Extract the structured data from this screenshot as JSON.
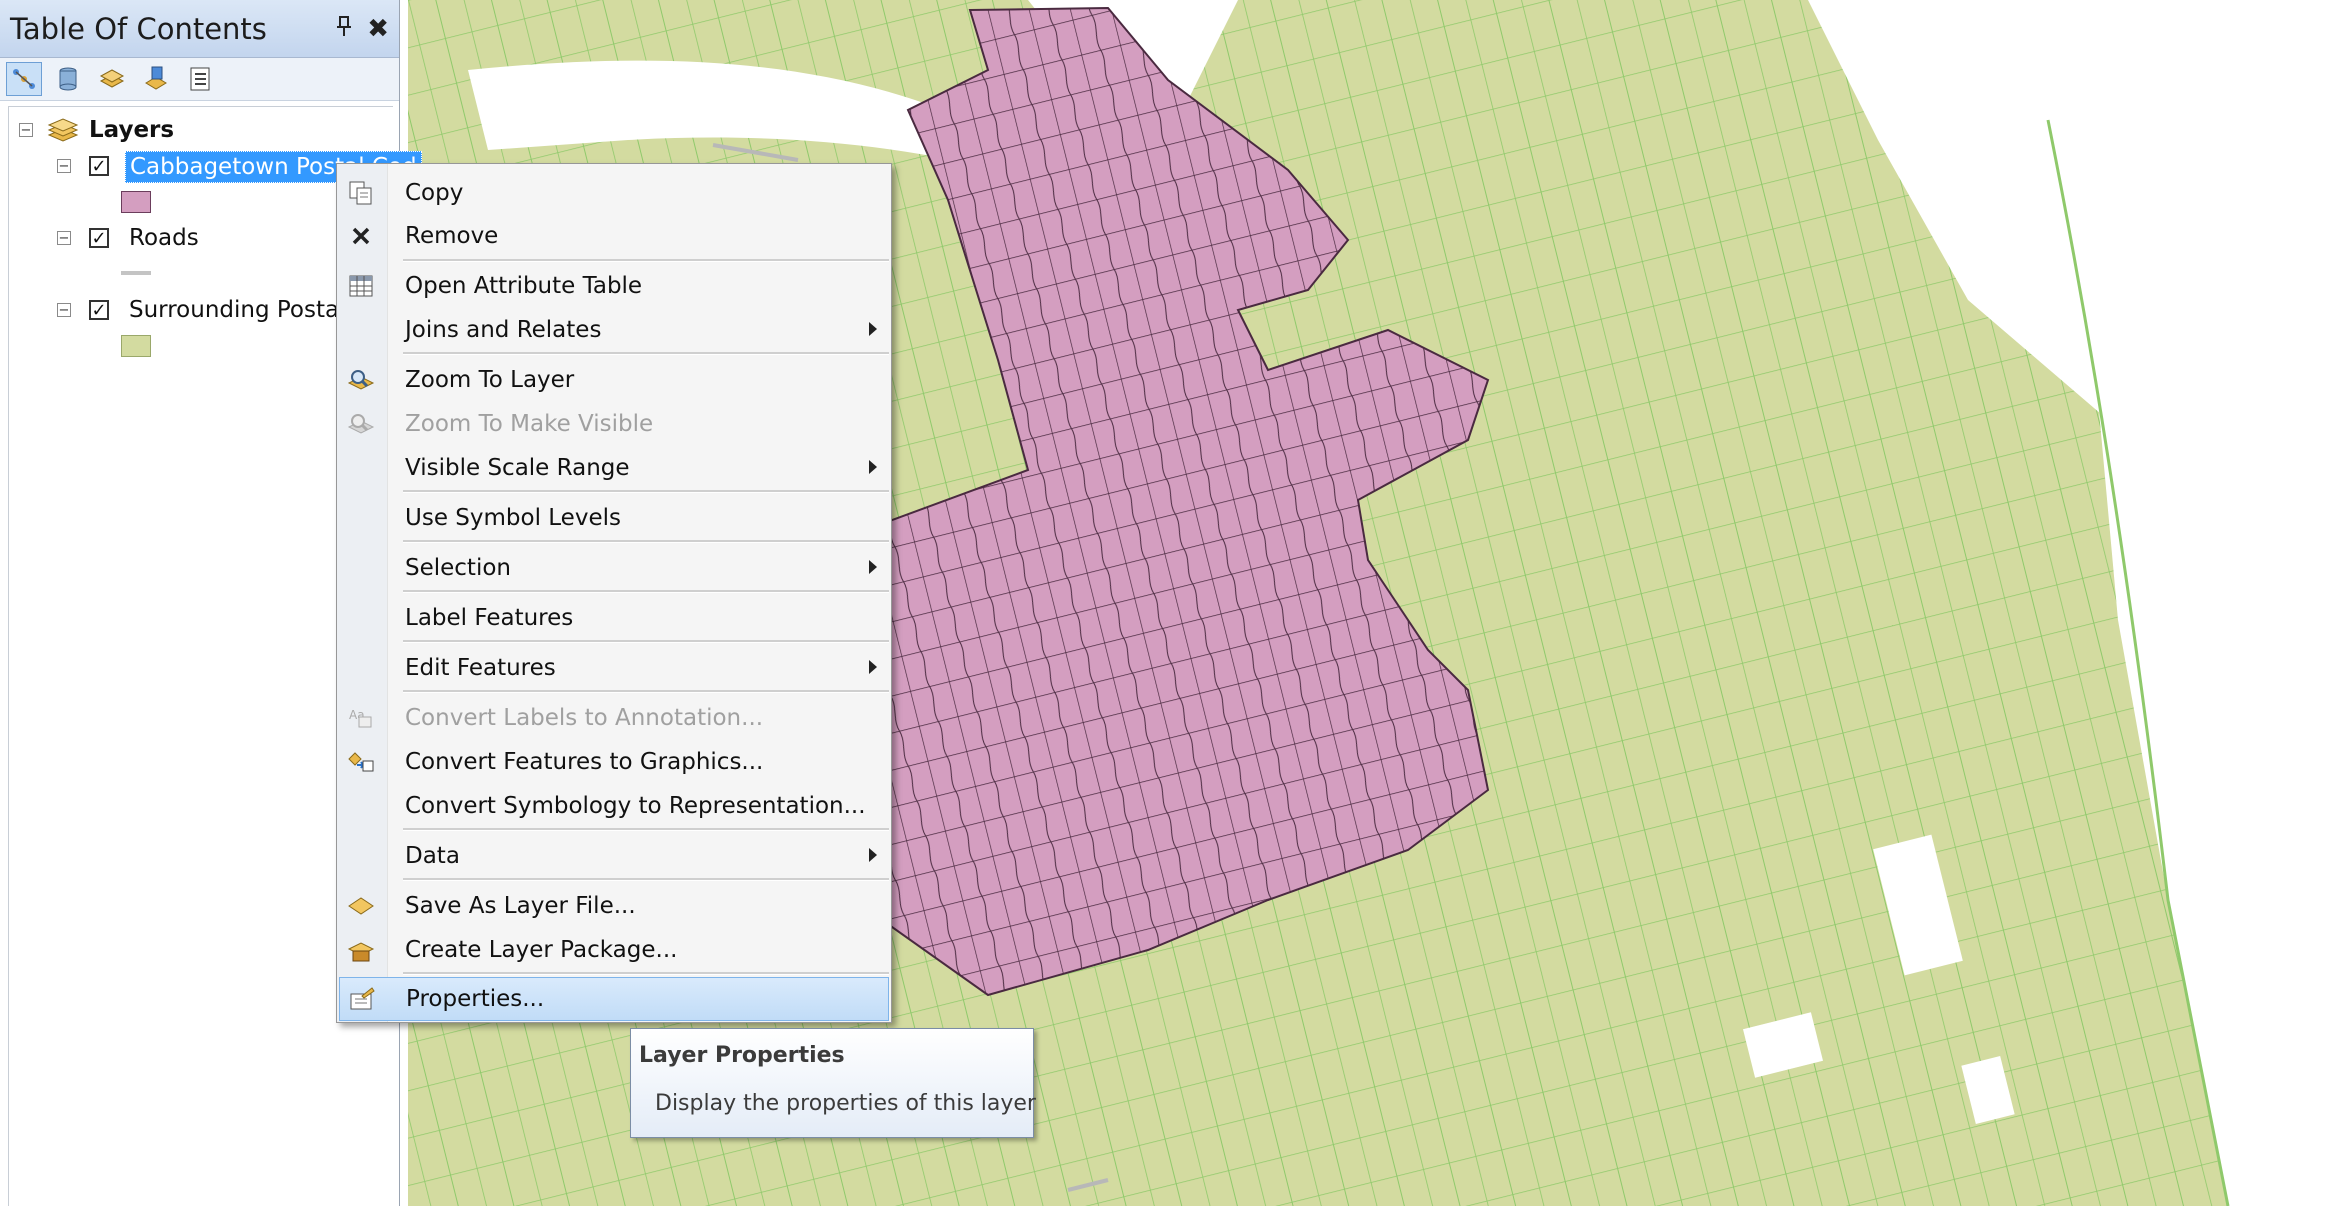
{
  "toc": {
    "title": "Table Of Contents",
    "pin_glyph": "✖",
    "toolbar": [
      {
        "name": "list-by-drawing-order-icon",
        "active": true
      },
      {
        "name": "list-by-source-icon",
        "active": false
      },
      {
        "name": "list-by-visibility-icon",
        "active": false
      },
      {
        "name": "list-by-selection-icon",
        "active": false
      },
      {
        "name": "options-icon",
        "active": false
      }
    ],
    "root_label": "Layers",
    "layers": [
      {
        "label": "Cabbagetown Postal Cod",
        "checked": true,
        "selected": true,
        "swatch": "#d49ec0",
        "swatch_type": "polygon"
      },
      {
        "label": "Roads",
        "checked": true,
        "selected": false,
        "swatch": "#c4c4c4",
        "swatch_type": "line"
      },
      {
        "label": "Surrounding Postal",
        "checked": true,
        "selected": false,
        "swatch": "#d3dba0",
        "swatch_type": "polygon"
      }
    ]
  },
  "context_menu": {
    "items": [
      {
        "label": "Copy",
        "icon": "copy-icon"
      },
      {
        "label": "Remove",
        "icon": "remove-icon"
      },
      {
        "label": "Open Attribute Table",
        "icon": "attribute-table-icon"
      },
      {
        "label": "Joins and Relates",
        "submenu": true
      },
      {
        "label": "Zoom To Layer",
        "icon": "zoom-to-layer-icon"
      },
      {
        "label": "Zoom To Make Visible",
        "icon": "zoom-to-visible-icon",
        "disabled": true
      },
      {
        "label": "Visible Scale Range",
        "submenu": true
      },
      {
        "label": "Use Symbol Levels"
      },
      {
        "label": "Selection",
        "submenu": true
      },
      {
        "label": "Label Features"
      },
      {
        "label": "Edit Features",
        "submenu": true
      },
      {
        "label": "Convert Labels to Annotation...",
        "icon": "convert-labels-icon",
        "disabled": true
      },
      {
        "label": "Convert Features to Graphics...",
        "icon": "convert-features-icon"
      },
      {
        "label": "Convert Symbology to Representation..."
      },
      {
        "label": "Data",
        "submenu": true
      },
      {
        "label": "Save As Layer File...",
        "icon": "save-layer-file-icon"
      },
      {
        "label": "Create Layer Package...",
        "icon": "layer-package-icon"
      },
      {
        "label": "Properties...",
        "icon": "properties-icon",
        "highlighted": true
      }
    ]
  },
  "tooltip": {
    "title": "Layer Properties",
    "description": "Display the properties of this layer"
  },
  "colors": {
    "map_background": "#d3dba0",
    "postal_boundary": "#8fc96b",
    "cabbagetown_fill": "#d49ec0",
    "cabbagetown_outline": "#4a2a40",
    "water": "#ffffff",
    "selection": "#3399ff"
  }
}
